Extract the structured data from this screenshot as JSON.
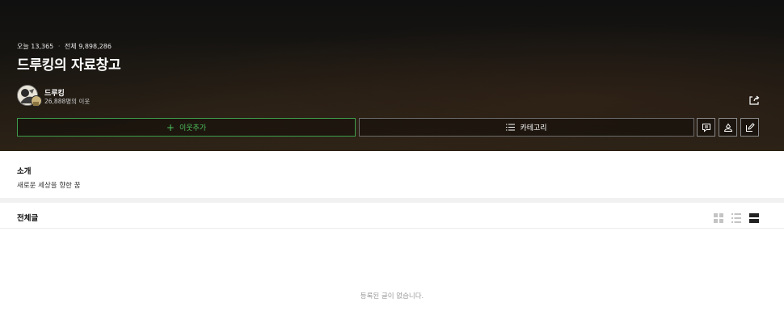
{
  "header": {
    "today_label": "오늘",
    "today_count": "13,365",
    "total_label": "전체",
    "total_count": "9,898,286",
    "blog_title": "드루킹의 자료창고"
  },
  "owner": {
    "name": "드루킹",
    "neighbors": "26,888명의 이웃"
  },
  "actions": {
    "add_neighbor": "이웃추가",
    "category": "카테고리"
  },
  "intro": {
    "title": "소개",
    "text": "새로운 세상을 향한 꿈"
  },
  "posts": {
    "title": "전체글",
    "empty_message": "등록된 글이 없습니다.",
    "selected_view": "list-wide"
  },
  "colors": {
    "accent_green": "#4fc35d",
    "hero_bg": "#14110d"
  },
  "icons": [
    "share-icon",
    "plus-icon",
    "list-icon",
    "guestbook-icon",
    "profile-icon",
    "write-icon",
    "grid-view-icon",
    "list-view-icon",
    "card-view-icon"
  ]
}
